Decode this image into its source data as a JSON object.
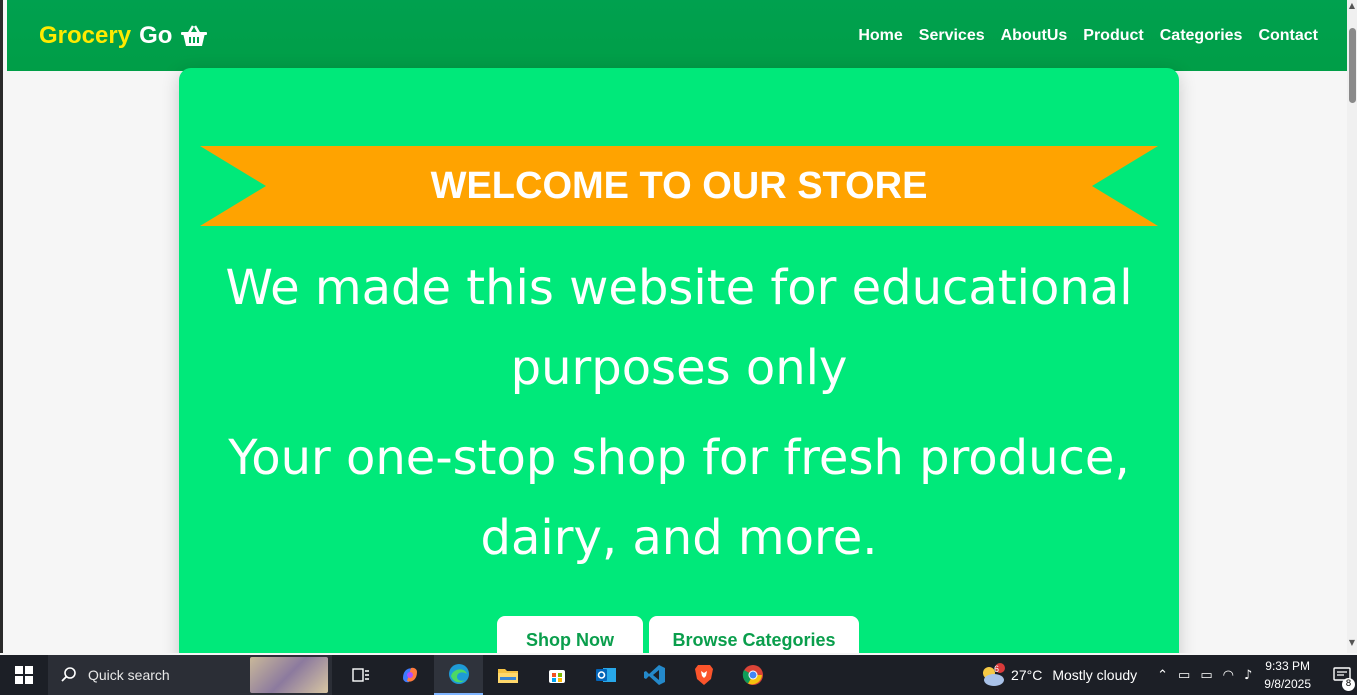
{
  "navbar": {
    "brand_part1": "Grocery",
    "brand_part2": "Go",
    "links": [
      "Home",
      "Services",
      "AboutUs",
      "Product",
      "Categories",
      "Contact"
    ]
  },
  "hero": {
    "ribbon_text": "WELCOME TO OUR STORE",
    "line1": "We made this website for educational purposes only",
    "line2": "Your one-stop shop for fresh produce, dairy, and more.",
    "shop_button": "Shop Now",
    "browse_button": "Browse Categories"
  },
  "colors": {
    "navbar": "#00a14f",
    "hero": "#00e97a",
    "ribbon": "#ffa300",
    "brand_accent": "#ffea00",
    "button_text": "#0a9e4c"
  },
  "taskbar": {
    "search_placeholder": "Quick search",
    "weather_temp": "27°C",
    "weather_desc": "Mostly cloudy",
    "weather_badge": "6",
    "time": "9:33 PM",
    "date": "9/8/2025",
    "notification_count": "8",
    "icons": [
      "task-view-icon",
      "copilot-icon",
      "edge-icon",
      "file-explorer-icon",
      "store-icon",
      "outlook-icon",
      "vscode-icon",
      "brave-icon",
      "chrome-icon"
    ]
  }
}
